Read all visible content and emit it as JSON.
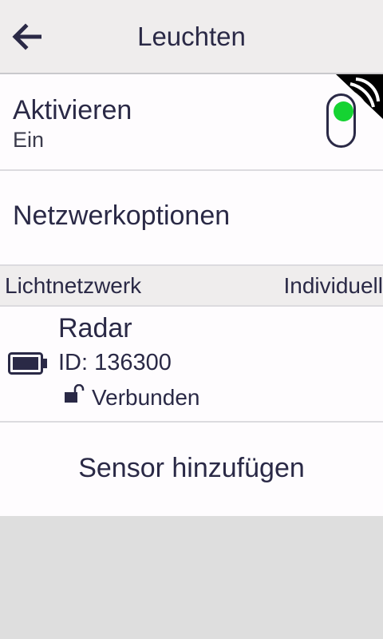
{
  "header": {
    "title": "Leuchten",
    "back_icon": "arrow-left-icon"
  },
  "activate": {
    "label": "Aktivieren",
    "value": "Ein",
    "toggle_on": true,
    "toggle_color": "#15d332"
  },
  "network_options": {
    "label": "Netzwerkoptionen"
  },
  "light_network": {
    "label": "Lichtnetzwerk",
    "value": "Individuell"
  },
  "sensor": {
    "name": "Radar",
    "id": "ID: 136300",
    "status": "Verbunden",
    "battery_icon": "battery-full-icon",
    "lock_icon": "unlocked-icon"
  },
  "add_sensor": {
    "label": "Sensor hinzufügen"
  },
  "colors": {
    "text": "#2a2946",
    "header_bg": "#efeded",
    "row_bg": "#fefcfe",
    "empty_bg": "#dedede"
  }
}
